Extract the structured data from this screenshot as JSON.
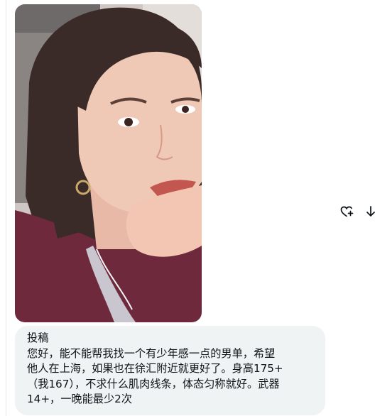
{
  "message": {
    "lines": [
      "投稿",
      "您好，能不能帮我找一个有少年感一点的男单，希望",
      "他人在上海，如果也在徐汇附近就更好了。身高175+",
      "（我167），不求什么肌肉线条，体态匀称就好。武器",
      "14+，一晚能最少2次"
    ]
  },
  "actions": {
    "react_icon": "heart-plus-icon",
    "download_icon": "arrow-down-icon"
  },
  "colors": {
    "bubble_bg": "#eff3f4",
    "text": "#0f1419",
    "icon": "#0f1419"
  }
}
